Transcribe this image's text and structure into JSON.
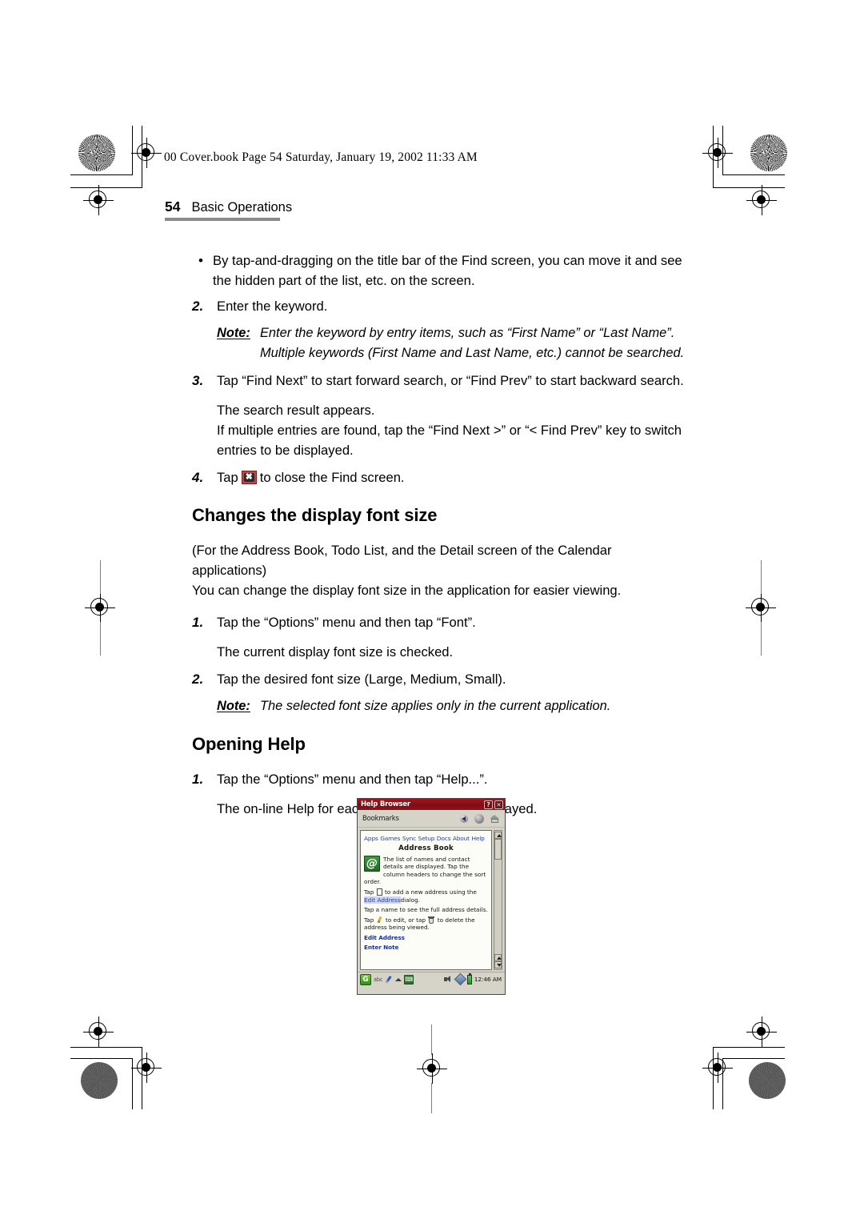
{
  "page": {
    "file_header": "00 Cover.book  Page 54  Saturday, January 19, 2002  11:33 AM",
    "page_number": "54",
    "section_title": "Basic Operations"
  },
  "body": {
    "bullet_mark": "•",
    "bullet_1": "By tap-and-dragging on the title bar of the Find screen, you can move it and see the hidden part of the list, etc. on the screen.",
    "step_2_num": "2.",
    "step_2_text": "Enter the keyword.",
    "note_1_label": "Note:",
    "note_1_text": "Enter the keyword by entry items, such as “First Name” or “Last Name”. Multiple keywords (First Name and Last Name, etc.) cannot be searched.",
    "step_3_num": "3.",
    "step_3_text": "Tap “Find Next” to start forward search, or “Find Prev” to start backward search.",
    "step_3_result_1": "The search result appears.",
    "step_3_result_2": "If multiple entries are found, tap the “Find Next >” or “< Find Prev” key to switch entries to be displayed.",
    "step_4_num": "4.",
    "step_4_text_before": "Tap",
    "step_4_icon_glyph": "✖",
    "step_4_text_after": "to close the Find screen."
  },
  "section_font": {
    "heading": "Changes the display font size",
    "intro_1": "(For the Address Book, Todo List, and the Detail screen of the Calendar applications)",
    "intro_2": "You can change the display font size in the application for easier viewing.",
    "step_1_num": "1.",
    "step_1_text": "Tap the “Options” menu and then tap “Font”.",
    "step_1_result": "The current display font size is checked.",
    "step_2_num": "2.",
    "step_2_text": "Tap the desired font size (Large, Medium, Small).",
    "note_label": "Note:",
    "note_text": "The selected font size applies only in the current application."
  },
  "section_help": {
    "heading": "Opening Help",
    "step_1_num": "1.",
    "step_1_text": "Tap the “Options” menu and then tap “Help...”.",
    "step_1_result": "The on-line Help for each application will be displayed."
  },
  "pda_screenshot": {
    "window_title": "Help Browser",
    "titlebar_help_button": "?",
    "titlebar_close_button": "✕",
    "toolbar_label": "Bookmarks",
    "toolbar_icons": [
      "back-arrow-icon",
      "forward-circle-icon",
      "home-icon"
    ],
    "nav_links": [
      "Apps",
      "Games",
      "Sync",
      "Setup",
      "Docs",
      "About",
      "Help"
    ],
    "page_heading": "Address Book",
    "app_icon_glyph": "@",
    "para_1": "The list of names and contact details are displayed. Tap the column headers to change the sort order.",
    "para_2_before": "Tap",
    "para_2_middle": "to add a new address using the",
    "para_2_link": "Edit Address",
    "para_2_after": "dialog.",
    "para_3": "Tap a name to see the full address details.",
    "para_4_before": "Tap",
    "para_4_middle": "to edit, or tap",
    "para_4_after": "to delete the address being viewed.",
    "link_1": "Edit Address",
    "link_2": "Enter Note",
    "status_start_glyph": "G",
    "status_abc": "abc",
    "status_kbd_glyph": "⌨",
    "status_time": "12:46 AM",
    "colors": {
      "titlebar": "#8f1219",
      "link": "#2a3fa8",
      "app_icon": "#2f8f2f",
      "battery": "#1d9e1d"
    }
  }
}
